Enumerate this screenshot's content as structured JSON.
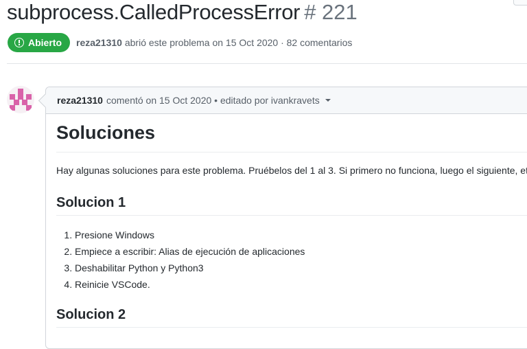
{
  "issue": {
    "title": "subprocess.CalledProcessError",
    "number": "# 221",
    "state": "Abierto",
    "author": "reza21310",
    "meta_rest": "abrió este problema on 15 Oct 2020 · 82 comentarios"
  },
  "comment": {
    "author": "reza21310",
    "meta": "comentó on 15 Oct 2020 • editado por ivankravets",
    "heading": "Soluciones",
    "intro": "Hay algunas soluciones para este problema. Pruébelos del 1 al 3. Si primero no funciona, luego el siguiente, etc.",
    "section1": "Solucion 1",
    "steps": [
      "Presione Windows",
      "Empiece a escribir: Alias de ejecución de aplicaciones",
      "Deshabilitar Python y Python3",
      "Reinicie VSCode."
    ],
    "section2": "Solucion 2"
  },
  "colors": {
    "open_badge": "#28a745",
    "avatar_pink": "#d962a9"
  }
}
